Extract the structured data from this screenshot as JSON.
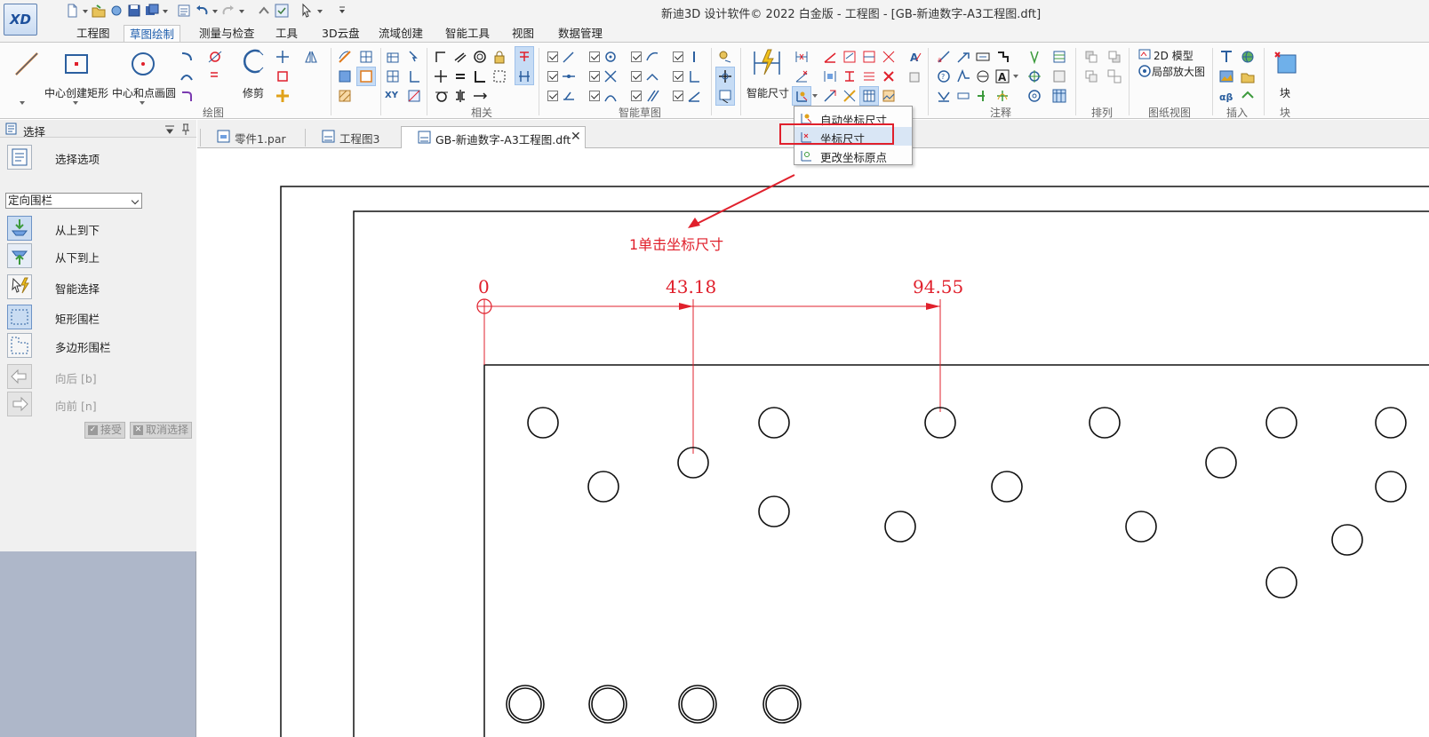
{
  "window": {
    "title": "新迪3D 设计软件© 2022 白金版 - 工程图 - [GB-新迪数字-A3工程图.dft]",
    "logo": "XD"
  },
  "ribbon_tabs": [
    {
      "label": "工程图",
      "active": false
    },
    {
      "label": "草图绘制",
      "active": true
    },
    {
      "label": "测量与检查",
      "active": false
    },
    {
      "label": "工具",
      "active": false
    },
    {
      "label": "3D云盘",
      "active": false
    },
    {
      "label": "流域创建",
      "active": false
    },
    {
      "label": "智能工具",
      "active": false
    },
    {
      "label": "视图",
      "active": false
    },
    {
      "label": "数据管理",
      "active": false
    }
  ],
  "ribbon": {
    "big_buttons": {
      "center_rect": "中心创建矩形",
      "center_circle": "中心和点画圆",
      "trim": "修剪",
      "smart_dim": "智能尺寸",
      "block": "块"
    },
    "small_text": {
      "model_2d": "2D 模型",
      "detail_view": "局部放大图",
      "xy": "XY"
    },
    "groups": {
      "draw": "绘图",
      "relate": "相关",
      "smart_sketch": "智能草图",
      "annotation": "注释",
      "arrange": "排列",
      "drawing_view": "图纸视图",
      "insert": "插入",
      "block": "块"
    }
  },
  "coord_menu": {
    "items": [
      {
        "label": "自动坐标尺寸",
        "highlighted": false
      },
      {
        "label": "坐标尺寸",
        "highlighted": true
      },
      {
        "label": "更改坐标原点",
        "highlighted": false
      }
    ]
  },
  "left_pane": {
    "title": "选择",
    "select_options": "选择选项",
    "fence_mode": "定向围栏",
    "items": [
      {
        "label": "从上到下",
        "selected": true,
        "disabled": false
      },
      {
        "label": "从下到上",
        "selected": false,
        "disabled": false
      },
      {
        "label": "智能选择",
        "selected": false,
        "disabled": false
      },
      {
        "label": "矩形围栏",
        "selected": true,
        "disabled": false
      },
      {
        "label": "多边形围栏",
        "selected": false,
        "disabled": false
      },
      {
        "label": "向后 [b]",
        "selected": false,
        "disabled": true
      },
      {
        "label": "向前 [n]",
        "selected": false,
        "disabled": true
      }
    ],
    "accept": "接受",
    "cancel": "取消选择"
  },
  "doc_tabs": [
    {
      "label": "零件1.par",
      "active": false
    },
    {
      "label": "工程图3",
      "active": false
    },
    {
      "label": "GB-新迪数字-A3工程图.dft",
      "active": true
    }
  ],
  "annotation": {
    "step_text": "1单击坐标尺寸",
    "color": "#e0202c"
  },
  "dimensions": {
    "values": [
      "0",
      "43.18",
      "94.55"
    ]
  },
  "colors": {
    "accent": "#1f5fae",
    "annotation_red": "#e0202c",
    "pane_bg": "#aeb7c9"
  }
}
